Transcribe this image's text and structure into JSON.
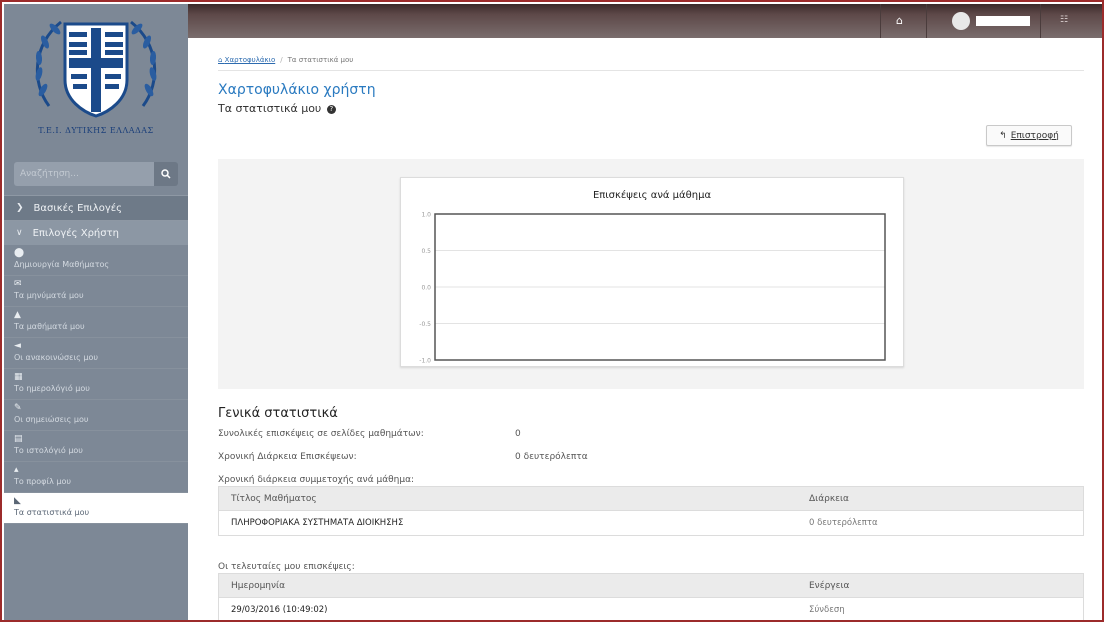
{
  "sidebar": {
    "logo_text": "T.E.I. ΔΥΤΙΚΗΣ ΕΛΛΑΔΑΣ",
    "search_placeholder": "Αναζήτηση...",
    "sections": {
      "basic": "Βασικές Επιλογές",
      "user": "Επιλογές Χρήστη"
    },
    "items": [
      {
        "icon": "plus-circle-icon",
        "label": "Δημιουργία Μαθήματος"
      },
      {
        "icon": "envelope-icon",
        "label": "Τα μηνύματά μου"
      },
      {
        "icon": "graduation-cap-icon",
        "label": "Τα μαθήματά μου"
      },
      {
        "icon": "bullhorn-icon",
        "label": "Οι ανακοινώσεις μου"
      },
      {
        "icon": "calendar-icon",
        "label": "Το ημερολόγιό μου"
      },
      {
        "icon": "edit-icon",
        "label": "Οι σημειώσεις μου"
      },
      {
        "icon": "blog-icon",
        "label": "Το ιστολόγιό μου"
      },
      {
        "icon": "user-icon",
        "label": "Το προφίλ μου"
      },
      {
        "icon": "area-chart-icon",
        "label": "Τα στατιστικά μου",
        "active": true
      }
    ]
  },
  "breadcrumb": {
    "home": "Χαρτοφυλάκιο",
    "current": "Τα στατιστικά μου"
  },
  "page": {
    "title": "Χαρτοφυλάκιο χρήστη",
    "subtitle": "Τα στατιστικά μου",
    "back_button": "Επιστροφή"
  },
  "chart_data": {
    "type": "line",
    "title": "Επισκέψεις ανά μάθημα",
    "xlabel": "",
    "ylabel": "",
    "ylim": [
      -1.0,
      1.0
    ],
    "yticks": [
      "1.0",
      "0.5",
      "0.0",
      "-0.5",
      "-1.0"
    ],
    "series": [],
    "grid": true
  },
  "general_stats": {
    "title": "Γενικά στατιστικά",
    "total_visits_label": "Συνολικές επισκέψεις σε σελίδες μαθημάτων:",
    "total_visits_value": "0",
    "duration_label": "Χρονική Διάρκεια Επισκέψεων:",
    "duration_value": "0 δευτερόλεπτα",
    "per_course_label": "Χρονική διάρκεια συμμετοχής ανά μάθημα:"
  },
  "course_table": {
    "headers": [
      "Τίτλος Μαθήματος",
      "Διάρκεια"
    ],
    "rows": [
      [
        "ΠΛΗΡΟΦΟΡΙΑΚΑ ΣΥΣΤΗΜΑΤΑ ΔΙΟΙΚΗΣΗΣ",
        "0 δευτερόλεπτα"
      ]
    ]
  },
  "last_visits": {
    "label": "Οι τελευταίες μου επισκέψεις:",
    "headers": [
      "Ημερομηνία",
      "Ενέργεια"
    ],
    "rows": [
      [
        "29/03/2016 (10:49:02)",
        "Σύνδεση"
      ]
    ]
  },
  "colors": {
    "accent": "#2a7ac0",
    "sidebar_bg": "#7d8896",
    "topbar_bg": "#5d4848"
  }
}
